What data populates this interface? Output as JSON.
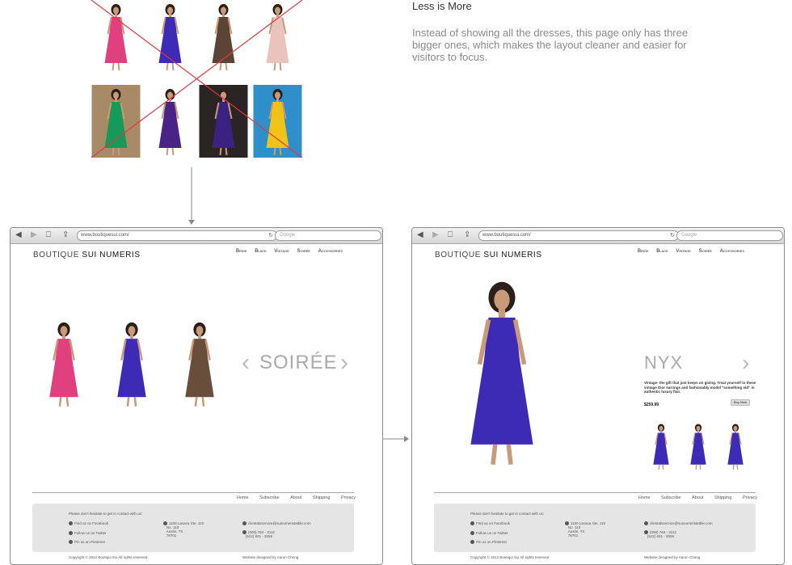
{
  "annotation": {
    "title": "Less is More",
    "body": "Instead of showing all the dresses, this page only has three bigger ones, which makes the layout cleaner and easier for visitors to focus."
  },
  "grid_photos": [
    {
      "name": "pink-dress-photo",
      "bg": "#ffffff",
      "dress": "#e0417e"
    },
    {
      "name": "blue-gown-photo",
      "bg": "#ffffff",
      "dress": "#3d2ab5"
    },
    {
      "name": "bronze-gown-photo",
      "bg": "#ffffff",
      "dress": "#5b4436"
    },
    {
      "name": "blush-dress-photo",
      "bg": "#ffffff",
      "dress": "#e9c3bc"
    },
    {
      "name": "green-dress-photo",
      "bg": "#a88a66",
      "dress": "#169a5a"
    },
    {
      "name": "purple-dress-photo",
      "bg": "#ffffff",
      "dress": "#4a2386"
    },
    {
      "name": "violet-dress-photo",
      "bg": "#2a2424",
      "dress": "#3b2280"
    },
    {
      "name": "yellow-dress-photo",
      "bg": "#2f8fca",
      "dress": "#f0c316"
    }
  ],
  "browser": {
    "url": "www.boutiquesui.com/",
    "search_placeholder": "Google",
    "reload_icon": "↻"
  },
  "site": {
    "logo_part1": "BOUTIQUE",
    "logo_part2": "SUI NUMERIS",
    "nav": [
      "Bride",
      "Black",
      "Vintage",
      "Soirée",
      "Accessories"
    ]
  },
  "left_page": {
    "category": "SOIRÉE",
    "prev_arrow": "‹",
    "next_arrow": "›",
    "thumbs": [
      {
        "name": "thumb-pink-dress",
        "dress": "#e0417e"
      },
      {
        "name": "thumb-blue-gown",
        "dress": "#3d2ab5"
      },
      {
        "name": "thumb-bronze-gown",
        "dress": "#6a4e3c"
      }
    ]
  },
  "right_page": {
    "product_name": "NYX",
    "next_arrow": "›",
    "description": "Vintage- the gift that just keeps on giving. Treat yourself to these vintage Dior earrings and fashionably model \"something old\" in authentic luxury flair.",
    "price": "$259.99",
    "buy_label": "Buy Now",
    "main_dress": "#3d2ab5",
    "small": [
      {
        "name": "small-front-view",
        "dress": "#3d2ab5"
      },
      {
        "name": "small-side-view",
        "dress": "#3d2ab5"
      },
      {
        "name": "small-detail-view",
        "dress": "#3d2ab5"
      }
    ]
  },
  "footer": {
    "links": [
      "Home",
      "Subscribe",
      "About",
      "Shipping",
      "Privacy"
    ],
    "contact_intro": "Please don't hesitate to get in contact with us:",
    "facebook": "Find us on Facebook",
    "twitter": "Follow us on Twitter",
    "pinterest": "Pin us on Pinterest",
    "address_l1": "1100 Lavaca Ste. 110",
    "address_l2": "No. 110",
    "address_l3": "Austin, TX",
    "address_l4": "78701",
    "email": "clientalsservice@suinumeristatble.com",
    "phone_l1": "(000) 784 - 3112",
    "phone_l2": "(512) 831 - 3059",
    "copyright": "Copyright © 2012 Boutiqui Sui All rights reserved.",
    "credit": "Website designed by  Aaron Cheng"
  }
}
